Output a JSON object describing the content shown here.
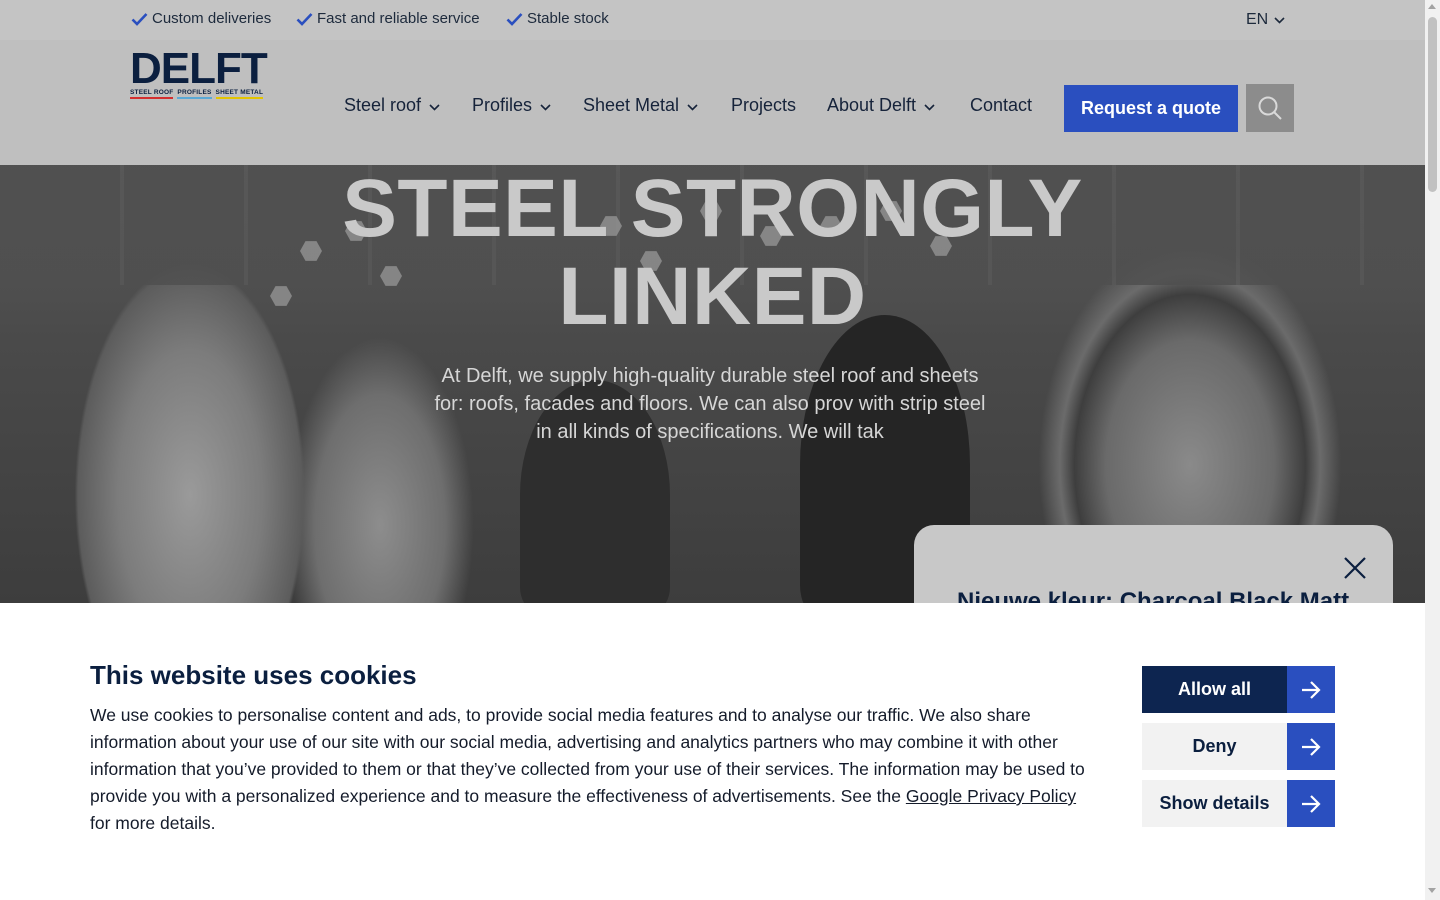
{
  "topbar": {
    "usps": [
      "Custom deliveries",
      "Fast and reliable service",
      "Stable stock"
    ],
    "language": "EN"
  },
  "header": {
    "logo_text": "DELFT",
    "logo_sub": [
      "STEEL ROOF",
      "PROFILES",
      "SHEET METAL"
    ],
    "nav": [
      {
        "label": "Steel roof",
        "has_dropdown": true
      },
      {
        "label": "Profiles",
        "has_dropdown": true
      },
      {
        "label": "Sheet Metal",
        "has_dropdown": true
      },
      {
        "label": "Projects",
        "has_dropdown": false
      },
      {
        "label": "About Delft",
        "has_dropdown": true
      },
      {
        "label": "Contact",
        "has_dropdown": false
      }
    ],
    "quote_button": "Request a quote",
    "search_icon": "search-icon"
  },
  "hero": {
    "title_line1": "STEEL STRONGLY",
    "title_line2": "LINKED",
    "text": "At Delft, we supply high-quality durable steel roof and sheets for: roofs, facades and floors. We can also prov with strip steel in all kinds of specifications. We will tak"
  },
  "promo": {
    "title": "Nieuwe kleur: Charcoal Black Matt",
    "close_icon": "close-icon"
  },
  "cookie": {
    "title": "This website uses cookies",
    "text_before_link": "We use cookies to personalise content and ads, to provide social media features and to analyse our traffic. We also share information about your use of our site with our social media, advertising and analytics partners who may combine it with other information that you’ve provided to them or that they’ve collected from your use of their services. The information may be used to provide you with a personalized experience and to measure the effectiveness of advertisements. See the ",
    "link_text": "Google Privacy Policy",
    "text_after_link": " for more details.",
    "buttons": {
      "allow_all": "Allow all",
      "deny": "Deny",
      "show_details": "Show details"
    }
  },
  "colors": {
    "brand_navy": "#0b1f3f",
    "accent_blue": "#2a4fbf"
  }
}
